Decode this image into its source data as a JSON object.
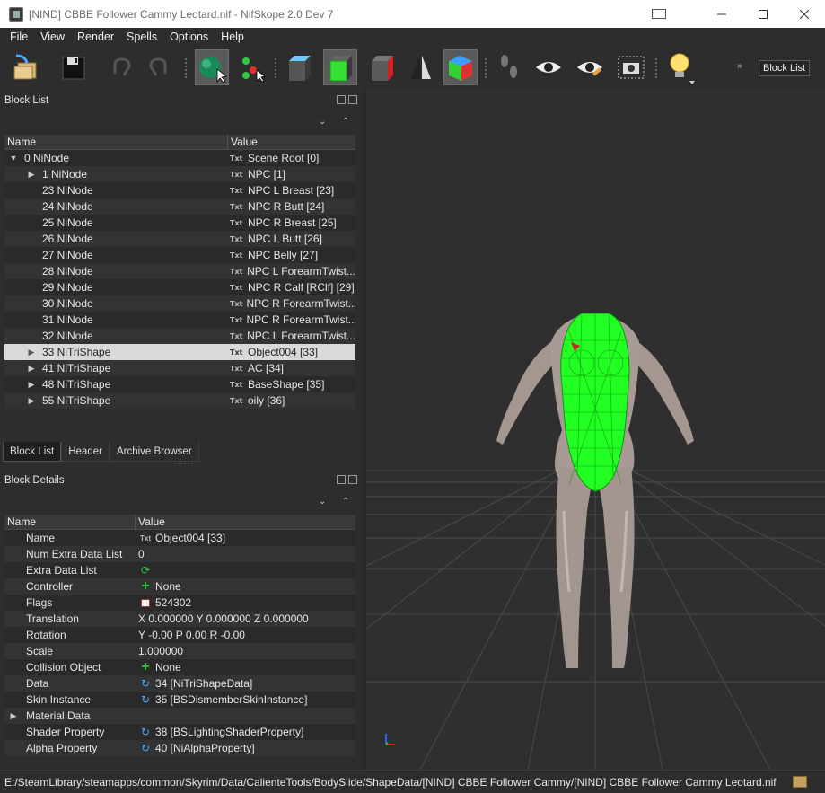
{
  "window": {
    "title": "[NIND] CBBE Follower Cammy Leotard.nif - NifSkope 2.0 Dev 7"
  },
  "menu": [
    "File",
    "View",
    "Render",
    "Spells",
    "Options",
    "Help"
  ],
  "toolbar": {
    "buttons": [
      {
        "name": "load-button",
        "icon": "load-icon"
      },
      {
        "name": "save-button",
        "icon": "save-icon"
      },
      {
        "name": "undo-button",
        "icon": "undo-icon"
      },
      {
        "name": "redo-button",
        "icon": "redo-icon"
      },
      {
        "name": "select-mode-button",
        "icon": "select-object-icon"
      },
      {
        "name": "select-vertex-button",
        "icon": "select-vertex-icon"
      },
      {
        "name": "view-top-button",
        "icon": "cube-top-icon"
      },
      {
        "name": "view-front-button",
        "icon": "cube-front-icon"
      },
      {
        "name": "view-side-button",
        "icon": "cube-side-icon"
      },
      {
        "name": "view-flip-button",
        "icon": "flip-icon"
      },
      {
        "name": "view-user-button",
        "icon": "cube-user-icon"
      },
      {
        "name": "walk-mode-button",
        "icon": "footsteps-icon"
      },
      {
        "name": "show-button",
        "icon": "eye-icon"
      },
      {
        "name": "show-hidden-button",
        "icon": "eye-edit-icon"
      },
      {
        "name": "screenshot-button",
        "icon": "camera-icon"
      },
      {
        "name": "lighting-button",
        "icon": "light-bulb-icon"
      }
    ],
    "overflow": "»",
    "block_list_label": "Block List"
  },
  "block_list": {
    "title": "Block List",
    "columns": [
      "Name",
      "Value"
    ],
    "rows": [
      {
        "arrow": "down",
        "indent": 0,
        "name": "0 NiNode",
        "value": "Scene Root [0]"
      },
      {
        "arrow": "right",
        "indent": 1,
        "name": "1 NiNode",
        "value": "NPC [1]"
      },
      {
        "arrow": "",
        "indent": 1,
        "name": "23 NiNode",
        "value": "NPC L Breast [23]"
      },
      {
        "arrow": "",
        "indent": 1,
        "name": "24 NiNode",
        "value": "NPC R Butt [24]"
      },
      {
        "arrow": "",
        "indent": 1,
        "name": "25 NiNode",
        "value": "NPC R Breast [25]"
      },
      {
        "arrow": "",
        "indent": 1,
        "name": "26 NiNode",
        "value": "NPC L Butt [26]"
      },
      {
        "arrow": "",
        "indent": 1,
        "name": "27 NiNode",
        "value": "NPC Belly [27]"
      },
      {
        "arrow": "",
        "indent": 1,
        "name": "28 NiNode",
        "value": "NPC L ForearmTwist..."
      },
      {
        "arrow": "",
        "indent": 1,
        "name": "29 NiNode",
        "value": "NPC R Calf [RClf] [29]"
      },
      {
        "arrow": "",
        "indent": 1,
        "name": "30 NiNode",
        "value": "NPC R ForearmTwist..."
      },
      {
        "arrow": "",
        "indent": 1,
        "name": "31 NiNode",
        "value": "NPC R ForearmTwist..."
      },
      {
        "arrow": "",
        "indent": 1,
        "name": "32 NiNode",
        "value": "NPC L ForearmTwist..."
      },
      {
        "arrow": "right",
        "indent": 1,
        "name": "33 NiTriShape",
        "value": "Object004 [33]",
        "selected": true
      },
      {
        "arrow": "right",
        "indent": 1,
        "name": "41 NiTriShape",
        "value": "AC [34]"
      },
      {
        "arrow": "right",
        "indent": 1,
        "name": "48 NiTriShape",
        "value": "BaseShape [35]"
      },
      {
        "arrow": "right",
        "indent": 1,
        "name": "55 NiTriShape",
        "value": "oily [36]"
      }
    ],
    "txt_icon": "Txt",
    "tabs": [
      "Block List",
      "Header",
      "Archive Browser"
    ]
  },
  "block_details": {
    "title": "Block Details",
    "columns": [
      "Name",
      "Value"
    ],
    "rows": [
      {
        "name": "Name",
        "icon": "txt",
        "value": "Object004 [33]"
      },
      {
        "name": "Num Extra Data List",
        "icon": "",
        "value": "0"
      },
      {
        "name": "Extra Data List",
        "icon": "refresh",
        "value": ""
      },
      {
        "name": "Controller",
        "icon": "plus",
        "value": "None"
      },
      {
        "name": "Flags",
        "icon": "flag",
        "value": "524302"
      },
      {
        "name": "Translation",
        "icon": "",
        "value": "X 0.000000 Y 0.000000 Z 0.000000"
      },
      {
        "name": "Rotation",
        "icon": "",
        "value": "Y -0.00 P 0.00 R -0.00"
      },
      {
        "name": "Scale",
        "icon": "",
        "value": "1.000000"
      },
      {
        "name": "Collision Object",
        "icon": "plus",
        "value": "None"
      },
      {
        "name": "Data",
        "icon": "link",
        "value": "34 [NiTriShapeData]"
      },
      {
        "name": "Skin Instance",
        "icon": "link",
        "value": "35 [BSDismemberSkinInstance]"
      },
      {
        "name": "Material Data",
        "icon": "",
        "value": "",
        "expandable": true
      },
      {
        "name": "Shader Property",
        "icon": "link",
        "value": "38 [BSLightingShaderProperty]"
      },
      {
        "name": "Alpha Property",
        "icon": "link",
        "value": "40 [NiAlphaProperty]"
      }
    ]
  },
  "status": {
    "path": "E:/SteamLibrary/steamapps/common/Skyrim/Data/CalienteTools/BodySlide/ShapeData/[NIND] CBBE Follower Cammy/[NIND] CBBE Follower Cammy Leotard.nif"
  },
  "colors": {
    "selection_mesh": "#00ff00",
    "body_skin": "#a89b96",
    "viewport_bg": "#2f2f2f"
  }
}
